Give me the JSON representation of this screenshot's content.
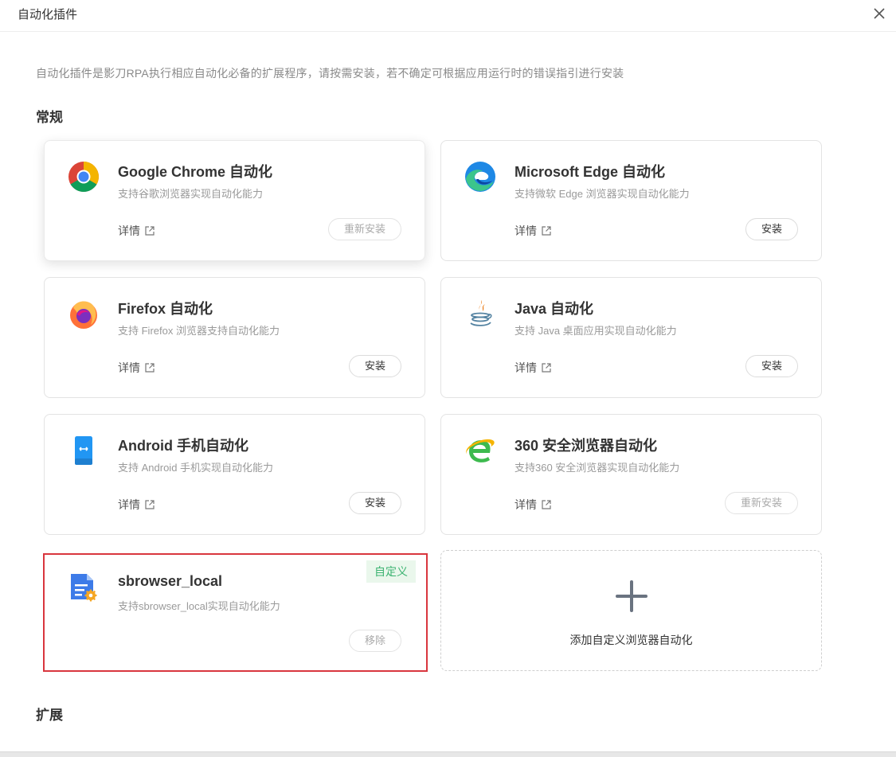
{
  "dialog": {
    "title": "自动化插件"
  },
  "intro": "自动化插件是影刀RPA执行相应自动化必备的扩展程序，请按需安装，若不确定可根据应用运行时的错误指引进行安装",
  "sections": {
    "general": "常规",
    "extension": "扩展"
  },
  "cards": [
    {
      "title": "Google Chrome 自动化",
      "desc": "支持谷歌浏览器实现自动化能力",
      "details": "详情",
      "button": "重新安装",
      "icon": "chrome-icon"
    },
    {
      "title": "Microsoft Edge 自动化",
      "desc": "支持微软 Edge 浏览器实现自动化能力",
      "details": "详情",
      "button": "安装",
      "icon": "edge-icon"
    },
    {
      "title": "Firefox 自动化",
      "desc": "支持 Firefox 浏览器支持自动化能力",
      "details": "详情",
      "button": "安装",
      "icon": "firefox-icon"
    },
    {
      "title": "Java 自动化",
      "desc": "支持 Java 桌面应用实现自动化能力",
      "details": "详情",
      "button": "安装",
      "icon": "java-icon"
    },
    {
      "title": "Android 手机自动化",
      "desc": "支持 Android 手机实现自动化能力",
      "details": "详情",
      "button": "安装",
      "icon": "android-phone-icon"
    },
    {
      "title": "360 安全浏览器自动化",
      "desc": "支持360 安全浏览器实现自动化能力",
      "details": "详情",
      "button": "重新安装",
      "icon": "360-browser-icon"
    },
    {
      "title": "sbrowser_local",
      "desc": "支持sbrowser_local实现自动化能力",
      "badge": "自定义",
      "button": "移除",
      "icon": "custom-browser-icon"
    }
  ],
  "add_custom": {
    "label": "添加自定义浏览器自动化",
    "icon": "plus-icon"
  },
  "colors": {
    "highlight_border": "#d9363e",
    "badge_bg": "#eaf7ec",
    "badge_text": "#3cb371"
  }
}
